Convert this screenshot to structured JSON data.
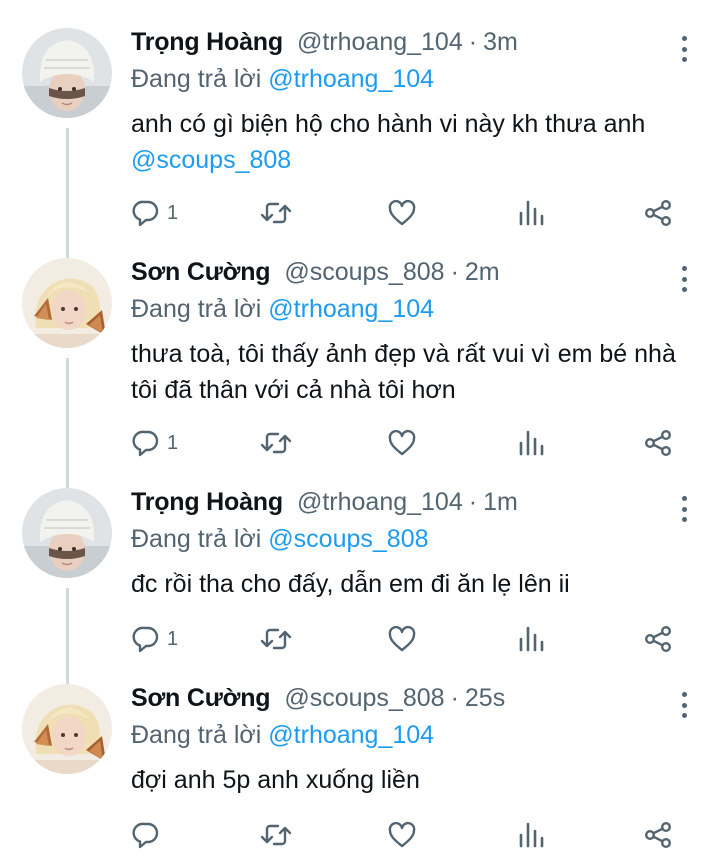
{
  "tweets": [
    {
      "display_name": "Trọng Hoàng",
      "handle": "@trhoang_104",
      "separator": "·",
      "time": "3m",
      "reply_prefix": "Đang trả lời",
      "reply_to": "@trhoang_104",
      "body_text": "anh có gì biện hộ cho hành vi này kh thưa anh",
      "body_mention": "@scoups_808",
      "reply_count": "1",
      "avatar": "avatar-trong-hoang"
    },
    {
      "display_name": "Sơn Cường",
      "handle": "@scoups_808",
      "separator": "·",
      "time": "2m",
      "reply_prefix": "Đang trả lời",
      "reply_to": "@trhoang_104",
      "body_text": "thưa toà, tôi thấy ảnh đẹp và rất vui vì em bé nhà tôi đã thân với cả nhà tôi hơn",
      "body_mention": "",
      "reply_count": "1",
      "avatar": "avatar-son-cuong"
    },
    {
      "display_name": "Trọng Hoàng",
      "handle": "@trhoang_104",
      "separator": "·",
      "time": "1m",
      "reply_prefix": "Đang trả lời",
      "reply_to": "@scoups_808",
      "body_text": "đc rồi tha cho đấy, dẫn em đi ăn lẹ lên ii",
      "body_mention": "",
      "reply_count": "1",
      "avatar": "avatar-trong-hoang"
    },
    {
      "display_name": "Sơn Cường",
      "handle": "@scoups_808",
      "separator": "·",
      "time": "25s",
      "reply_prefix": "Đang trả lời",
      "reply_to": "@trhoang_104",
      "body_text": "đợi anh 5p anh xuống liền",
      "body_mention": "",
      "reply_count": "",
      "avatar": "avatar-son-cuong"
    }
  ],
  "icons": {
    "reply": "reply-icon",
    "retweet": "retweet-icon",
    "like": "heart-icon",
    "analytics": "analytics-icon",
    "share": "share-icon",
    "more": "more-icon"
  },
  "colors": {
    "mention": "#1d9bf0",
    "secondary_text": "#536471",
    "primary_text": "#0f1419",
    "thread_line": "#cfd9de"
  }
}
